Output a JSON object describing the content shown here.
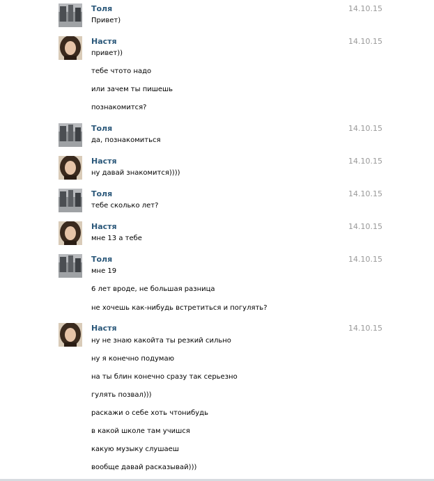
{
  "messages": [
    {
      "author": "Толя",
      "avatar": "tolya-avatar",
      "date": "14.10.15",
      "lines": [
        "Привет)"
      ]
    },
    {
      "author": "Настя",
      "avatar": "nastya-avatar",
      "date": "14.10.15",
      "lines": [
        "привет))",
        "тебе чтото надо",
        "или зачем ты пишешь",
        "познакомится?"
      ]
    },
    {
      "author": "Толя",
      "avatar": "tolya-avatar",
      "date": "14.10.15",
      "lines": [
        "да, познакомиться"
      ]
    },
    {
      "author": "Настя",
      "avatar": "nastya-avatar",
      "date": "14.10.15",
      "lines": [
        "ну давай знакомится))))"
      ]
    },
    {
      "author": "Толя",
      "avatar": "tolya-avatar",
      "date": "14.10.15",
      "lines": [
        "тебе сколько лет?"
      ]
    },
    {
      "author": "Настя",
      "avatar": "nastya-avatar",
      "date": "14.10.15",
      "lines": [
        "мне 13 а тебе"
      ]
    },
    {
      "author": "Толя",
      "avatar": "tolya-avatar",
      "date": "14.10.15",
      "lines": [
        "мне 19",
        "6 лет вроде, не большая разница",
        "не хочешь как-нибудь встретиться и погулять?"
      ]
    },
    {
      "author": "Настя",
      "avatar": "nastya-avatar",
      "date": "14.10.15",
      "lines": [
        "ну не знаю какойта ты резкий сильно",
        "ну я конечно подумаю",
        "на ты блин конечно сразу так серьезно",
        "гулять позвал)))",
        "раскажи о себе хоть чтонибудь",
        "в какой школе там учишся",
        "какую музыку слушаеш",
        "вообще давай расказывай)))"
      ]
    }
  ]
}
